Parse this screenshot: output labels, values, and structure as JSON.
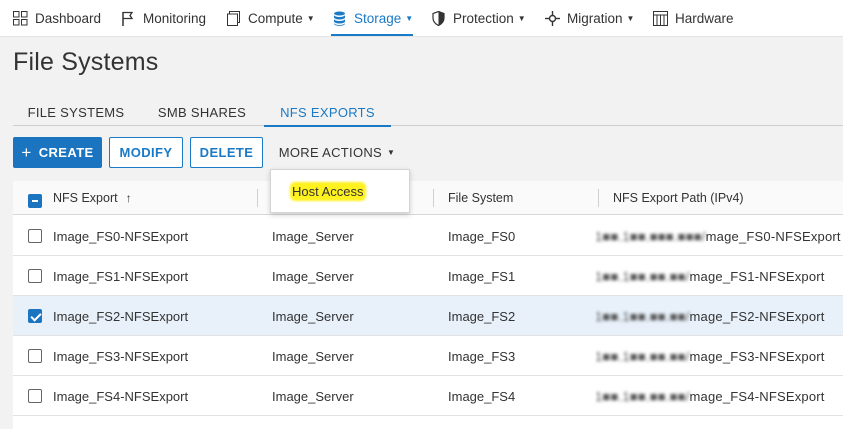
{
  "nav": {
    "items": [
      {
        "label": "Dashboard"
      },
      {
        "label": "Monitoring"
      },
      {
        "label": "Compute"
      },
      {
        "label": "Storage"
      },
      {
        "label": "Protection"
      },
      {
        "label": "Migration"
      },
      {
        "label": "Hardware"
      }
    ],
    "active": "Storage",
    "accent_color": "#1a7ac6"
  },
  "page": {
    "title": "File Systems"
  },
  "tabs": [
    {
      "label": "FILE SYSTEMS"
    },
    {
      "label": "SMB SHARES"
    },
    {
      "label": "NFS EXPORTS"
    }
  ],
  "active_tab": "NFS EXPORTS",
  "toolbar": {
    "create": "CREATE",
    "modify": "MODIFY",
    "delete": "DELETE",
    "more": "MORE ACTIONS"
  },
  "dropdown": {
    "items": [
      {
        "label": "Host Access",
        "highlighted": true
      }
    ],
    "highlight_color": "#fff21e"
  },
  "table": {
    "columns": [
      "NFS Export",
      "File System",
      "NFS Export Path (IPv4)"
    ],
    "sort": "ascending",
    "rows": [
      {
        "export": "Image_FS0-NFSExport",
        "server": "Image_Server",
        "fs": "Image_FS0",
        "path_hidden": "1■■.1■■.■■■.■■■/",
        "path_visible": "mage_FS0-NFSExport",
        "checked": false
      },
      {
        "export": "Image_FS1-NFSExport",
        "server": "Image_Server",
        "fs": "Image_FS1",
        "path_hidden": "1■■.1■■.■■.■■/",
        "path_visible": "mage_FS1-NFSExport",
        "checked": false
      },
      {
        "export": "Image_FS2-NFSExport",
        "server": "Image_Server",
        "fs": "Image_FS2",
        "path_hidden": "1■■.1■■.■■.■■/",
        "path_visible": "mage_FS2-NFSExport",
        "checked": true
      },
      {
        "export": "Image_FS3-NFSExport",
        "server": "Image_Server",
        "fs": "Image_FS3",
        "path_hidden": "1■■.1■■.■■.■■/",
        "path_visible": "mage_FS3-NFSExport",
        "checked": false
      },
      {
        "export": "Image_FS4-NFSExport",
        "server": "Image_Server",
        "fs": "Image_FS4",
        "path_hidden": "1■■.1■■.■■.■■/",
        "path_visible": "mage_FS4-NFSExport",
        "checked": false
      }
    ]
  }
}
